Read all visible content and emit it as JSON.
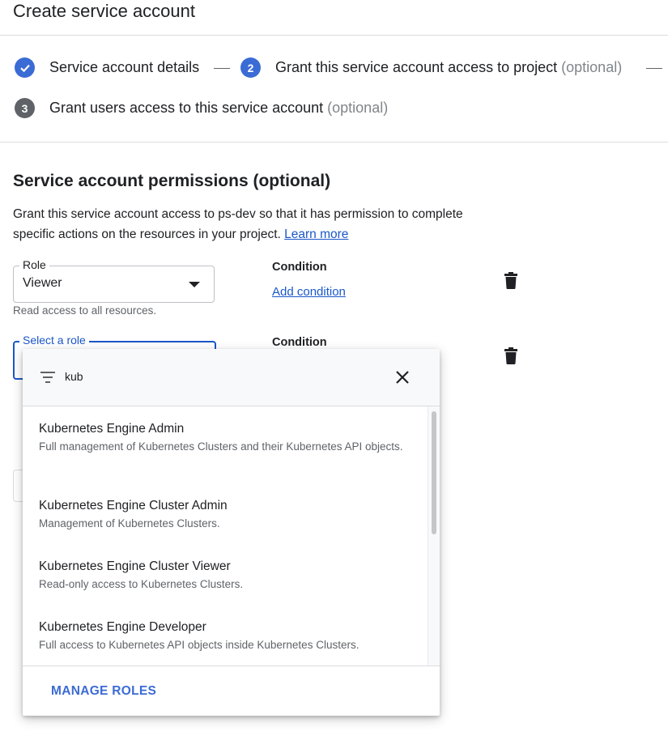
{
  "page": {
    "title": "Create service account"
  },
  "stepper": {
    "steps": [
      {
        "number": "",
        "label": "Service account details",
        "optional": "",
        "state": "done"
      },
      {
        "number": "2",
        "label": "Grant this service account access to project",
        "optional": "(optional)",
        "state": "active"
      },
      {
        "number": "3",
        "label": "Grant users access to this service account",
        "optional": "(optional)",
        "state": "todo"
      }
    ]
  },
  "permissions": {
    "title": "Service account permissions (optional)",
    "description": "Grant this service account access to ps-dev so that it has permission to complete specific actions on the resources in your project.",
    "learn_more": "Learn more"
  },
  "role_rows": [
    {
      "field_label": "Role",
      "value": "Viewer",
      "hint": "Read access to all resources.",
      "condition_label": "Condition",
      "add_condition": "Add condition"
    },
    {
      "field_label": "Select a role",
      "value": "",
      "condition_label": "Condition"
    }
  ],
  "role_picker": {
    "filter_value": "kub",
    "items": [
      {
        "title": "Kubernetes Engine Admin",
        "description": "Full management of Kubernetes Clusters and their Kubernetes API objects."
      },
      {
        "title": "Kubernetes Engine Cluster Admin",
        "description": "Management of Kubernetes Clusters."
      },
      {
        "title": "Kubernetes Engine Cluster Viewer",
        "description": "Read-only access to Kubernetes Clusters."
      },
      {
        "title": "Kubernetes Engine Developer",
        "description": "Full access to Kubernetes API objects inside Kubernetes Clusters."
      }
    ],
    "manage_roles": "MANAGE ROLES"
  },
  "colors": {
    "accent": "#1a57c9",
    "step_active": "#3b6bd4",
    "step_inactive": "#5f6368"
  },
  "icons": {
    "step1": "check-icon",
    "filter": "filter-icon",
    "close": "close-icon",
    "delete": "trash-icon",
    "dropdown": "caret-down-icon"
  }
}
